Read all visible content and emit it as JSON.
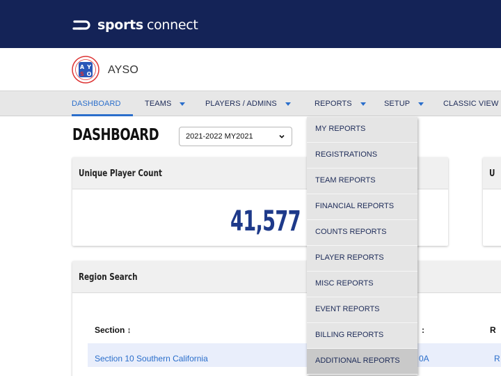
{
  "brand": {
    "logo_icon": "sports-connect-logo-icon",
    "name_bold": "sports",
    "name_light": "connect"
  },
  "org": {
    "logo_icon": "ayso-logo-icon",
    "name": "AYSO",
    "logo_text": "AYSO"
  },
  "nav": {
    "dashboard": "DASHBOARD",
    "teams": "TEAMS",
    "players_admins": "PLAYERS / ADMINS",
    "reports": "REPORTS",
    "setup": "SETUP",
    "classic_view": "CLASSIC VIEW"
  },
  "page": {
    "title": "DASHBOARD",
    "season_value": "2021-2022 MY2021"
  },
  "cards": {
    "unique_player": {
      "title": "Unique Player Count",
      "value": "41,577"
    },
    "second": {
      "title": "U"
    },
    "region_search": {
      "title": "Region Search",
      "columns": {
        "section": "Section ↕",
        "fragment": ":",
        "right": "R"
      },
      "row": {
        "section": "Section 10 Southern California",
        "fragment": "0A",
        "right": "R"
      }
    }
  },
  "reports_menu": [
    "MY REPORTS",
    "REGISTRATIONS",
    "TEAM REPORTS",
    "FINANCIAL REPORTS",
    "COUNTS REPORTS",
    "PLAYER REPORTS",
    "MISC REPORTS",
    "EVENT REPORTS",
    "BILLING REPORTS",
    "ADDITIONAL REPORTS"
  ],
  "colors": {
    "topbar": "#142357",
    "accent": "#2a6ecb",
    "number": "#1e3a8a"
  }
}
